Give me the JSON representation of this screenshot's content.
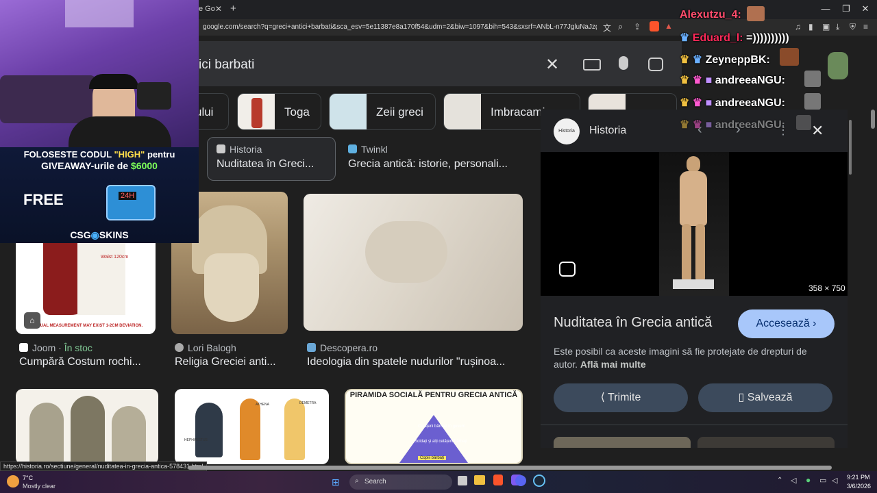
{
  "browser": {
    "tab_title": "e Go",
    "url": "google.com/search?q=greci+antici+barbati&sca_esv=5e11387e8a170f54&udm=2&biw=1097&bih=543&sxsrf=ANbL-n77JgluNaJzg_Pit2...",
    "status_url": "https://historia.ro/sectiune/general/nuditatea-in-grecia-antica-578431.html"
  },
  "search": {
    "query": "ici barbati"
  },
  "chips": [
    {
      "label": "ului"
    },
    {
      "label": "Toga"
    },
    {
      "label": "Zeii greci"
    },
    {
      "label": "Imbracami"
    }
  ],
  "results_row1": [
    {
      "source": "Historia",
      "title": "Nuditatea în Greci..."
    },
    {
      "source": "Twinkl",
      "title": "Grecia antică: istorie, personali..."
    }
  ],
  "results_row2": [
    {
      "source": "Joom",
      "badge": "În stoc",
      "title": "Cumpără Costum rochi...",
      "img_text": "Waist 120cm",
      "img_caption": "MANUAL MEASUREMENT MAY EXIST 1-2CM DEVIATION."
    },
    {
      "source": "Lori Balogh",
      "title": "Religia Greciei anti..."
    },
    {
      "source": "Descopera.ro",
      "title": "Ideologia din spatele nudurilor \"rușinoa..."
    }
  ],
  "results_row3": [
    {
      "img_text": ""
    },
    {
      "img_labels": [
        "HEPHAESTUS",
        "ATHENA",
        "DEMETRA"
      ]
    },
    {
      "img_title": "PIRAMIDA SOCIALĂ PENTRU GRECIA ANTICĂ",
      "img_labels": [
        "Cetățeni bărbați în guvern",
        "Soldați și alți cetățeni bărbați",
        "Copiii bărbați"
      ]
    }
  ],
  "panel": {
    "site": "Historia",
    "dimensions": "358 × 750",
    "title": "Nuditatea în Grecia antică",
    "visit_label": "Accesează",
    "notice": "Este posibil ca aceste imagini să fie protejate de drepturi de autor.",
    "learn_more": "Află mai multe",
    "share_label": "Trimite",
    "save_label": "Salvează"
  },
  "promo": {
    "line1_a": "FOLOSESTE CODUL ",
    "line1_b": "\"HIGH\"",
    "line1_c": " pentru",
    "line2_a": "GIVEAWAY-urile de ",
    "line2_b": "$6000",
    "free": "FREE",
    "brand": "CSG",
    "brand2": "SKINS",
    "case_label": "24H"
  },
  "chat": [
    {
      "user": "Alexutzu_4:",
      "msg": "",
      "color": "#ff4d6d"
    },
    {
      "user": "Eduard_l:",
      "msg": "=))))))))))",
      "color": "#ff2a5a"
    },
    {
      "user": "ZeyneppBK:",
      "msg": "",
      "color": "#ffffff"
    },
    {
      "user": "andreeaNGU:",
      "msg": "",
      "color": "#ffffff"
    },
    {
      "user": "andreeaNGU:",
      "msg": "",
      "color": "#ffffff"
    },
    {
      "user": "andreeaNGU:",
      "msg": "",
      "color": "#cccccc"
    }
  ],
  "taskbar": {
    "temp": "7°C",
    "weather": "Mostly clear",
    "search_label": "Search",
    "time": "9:21 PM",
    "date": "3/6/2026"
  },
  "colors": {
    "accent_blue": "#a8c7fa",
    "panel_button": "#3c4a5c",
    "green_badge": "#81c995"
  }
}
